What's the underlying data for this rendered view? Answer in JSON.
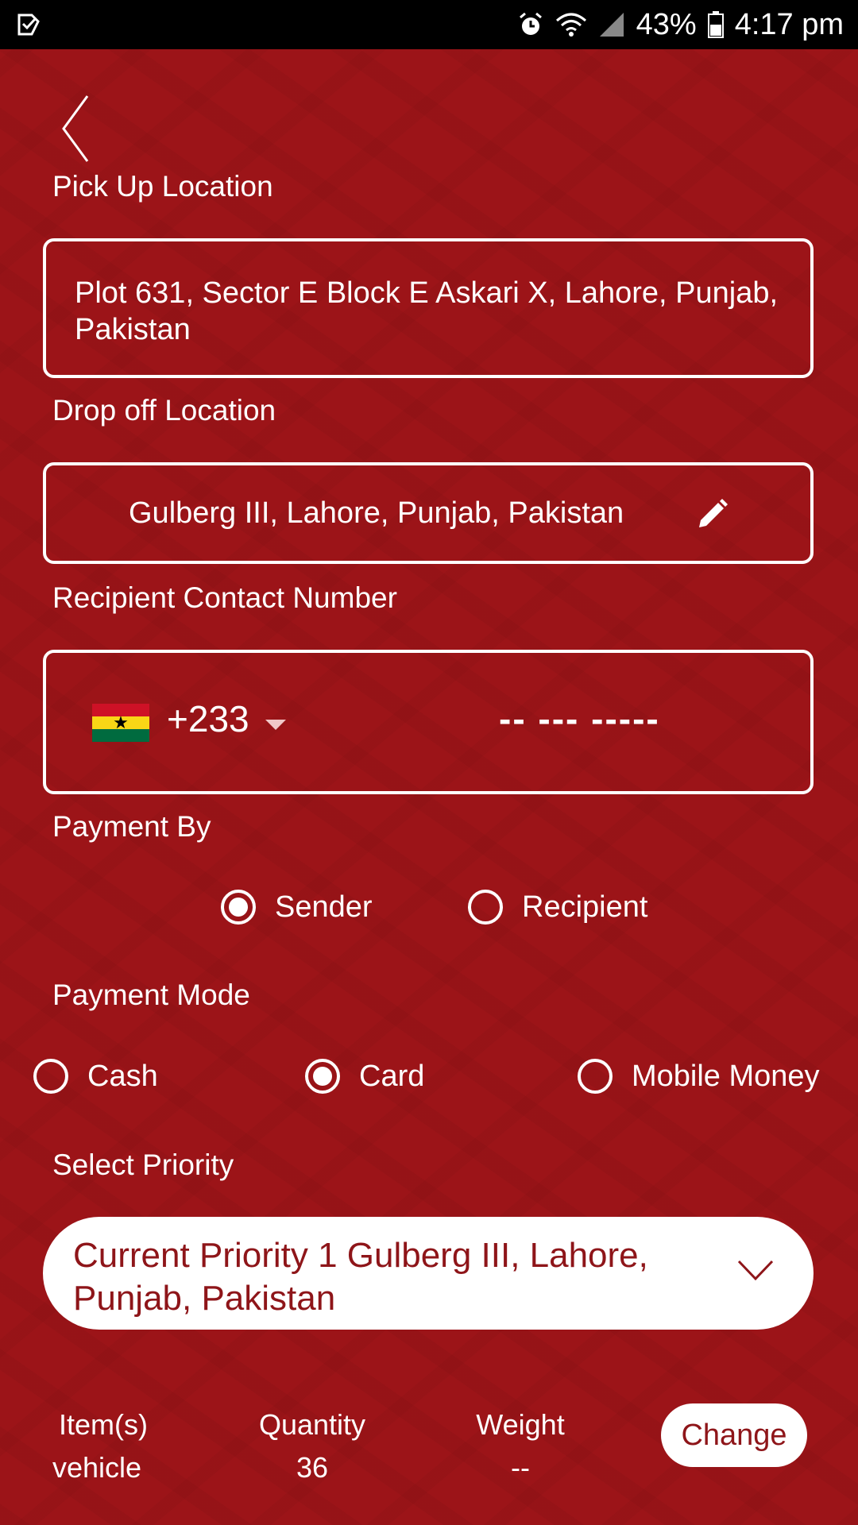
{
  "status_bar": {
    "battery": "43%",
    "time": "4:17 pm"
  },
  "form": {
    "pickup_label": "Pick Up Location",
    "pickup_value": "Plot 631, Sector E Block E Askari X, Lahore, Punjab, Pakistan",
    "dropoff_label": "Drop off Location",
    "dropoff_value": "Gulberg III, Lahore, Punjab, Pakistan",
    "contact_label": "Recipient Contact Number",
    "country_code": "+233",
    "phone_placeholder": "-- --- -----",
    "payment_by_label": "Payment By",
    "payment_by_options": [
      "Sender",
      "Recipient"
    ],
    "payment_by_selected": "Sender",
    "payment_mode_label": "Payment Mode",
    "payment_mode_options": [
      "Cash",
      "Card",
      "Mobile Money"
    ],
    "payment_mode_selected": "Card",
    "priority_label": "Select Priority",
    "priority_value": "Current Priority 1 Gulberg III, Lahore, Punjab, Pakistan"
  },
  "summary": {
    "items_header": "Item(s)",
    "items_value": "vehicle",
    "quantity_header": "Quantity",
    "quantity_value": "36",
    "weight_header": "Weight",
    "weight_value": "--",
    "change_label": "Change"
  },
  "icons": {
    "back": "chevron-left-icon",
    "edit": "pencil-icon",
    "dropdown": "chevron-down-icon",
    "flag": "ghana-flag-icon"
  },
  "colors": {
    "background": "#9c1418",
    "accent_text": "#8e1519",
    "white": "#ffffff"
  }
}
